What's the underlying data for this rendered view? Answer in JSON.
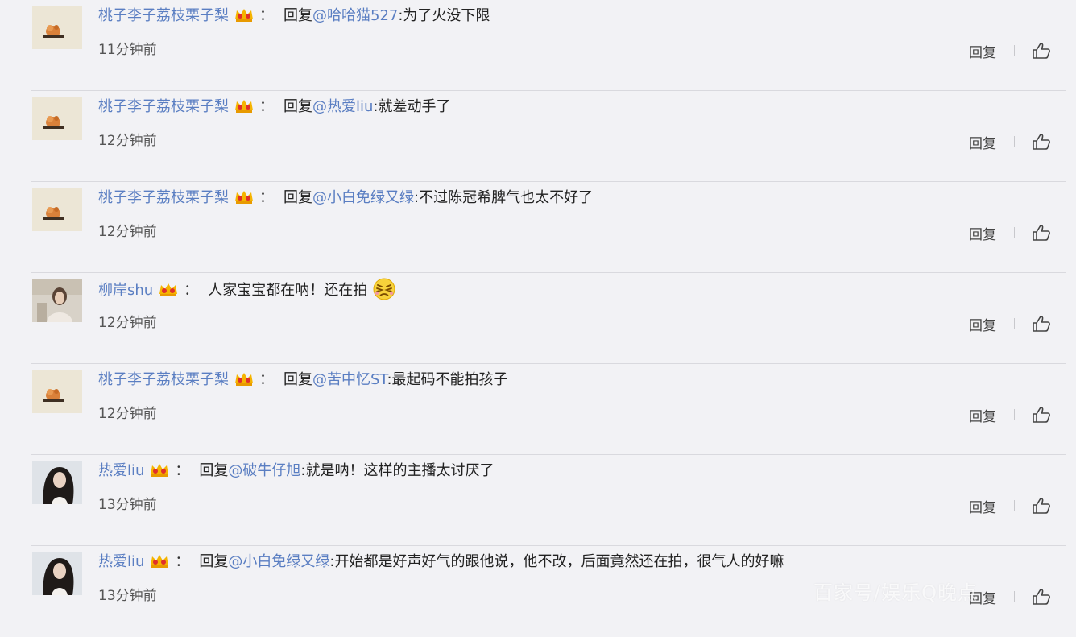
{
  "comments": [
    {
      "user": "桃子李子荔枝栗子梨",
      "avatar": "avatar-flower",
      "reply_prefix": "回复",
      "mention": "@哈哈猫527",
      "text": ":为了火没下限",
      "time": "11分钟前"
    },
    {
      "user": "桃子李子荔枝栗子梨",
      "avatar": "avatar-flower",
      "reply_prefix": "回复",
      "mention": "@热爱liu",
      "text": ":就差动手了",
      "time": "12分钟前"
    },
    {
      "user": "桃子李子荔枝栗子梨",
      "avatar": "avatar-flower",
      "reply_prefix": "回复",
      "mention": "@小白免绿又绿",
      "text": ":不过陈冠希脾气也太不好了",
      "time": "12分钟前"
    },
    {
      "user": "柳岸shu",
      "avatar": "avatar-girl-light",
      "reply_prefix": "",
      "mention": "",
      "text": "人家宝宝都在呐！还在拍",
      "time": "12分钟前",
      "emoji": "angry-face-emoji"
    },
    {
      "user": "桃子李子荔枝栗子梨",
      "avatar": "avatar-flower",
      "reply_prefix": "回复",
      "mention": "@苦中忆ST",
      "text": ":最起码不能拍孩子",
      "time": "12分钟前"
    },
    {
      "user": "热爱liu",
      "avatar": "avatar-girl-dark",
      "reply_prefix": "回复",
      "mention": "@破牛仔旭",
      "text": ":就是呐！这样的主播太讨厌了",
      "time": "13分钟前"
    },
    {
      "user": "热爱liu",
      "avatar": "avatar-girl-dark",
      "reply_prefix": "回复",
      "mention": "@小白免绿又绿",
      "text": ":开始都是好声好气的跟他说，他不改，后面竟然还在拍，很气人的好嘛",
      "time": "13分钟前"
    }
  ],
  "labels": {
    "colon": "：",
    "reply_button": "回复"
  },
  "icons": {
    "crown": "crown-vip-icon",
    "like": "thumbs-up-icon"
  },
  "watermark": "百家号/娱乐Q晚点",
  "colors": {
    "username": "#5a7ec2",
    "background": "#f2f2f5",
    "divider": "#d9d9de"
  }
}
